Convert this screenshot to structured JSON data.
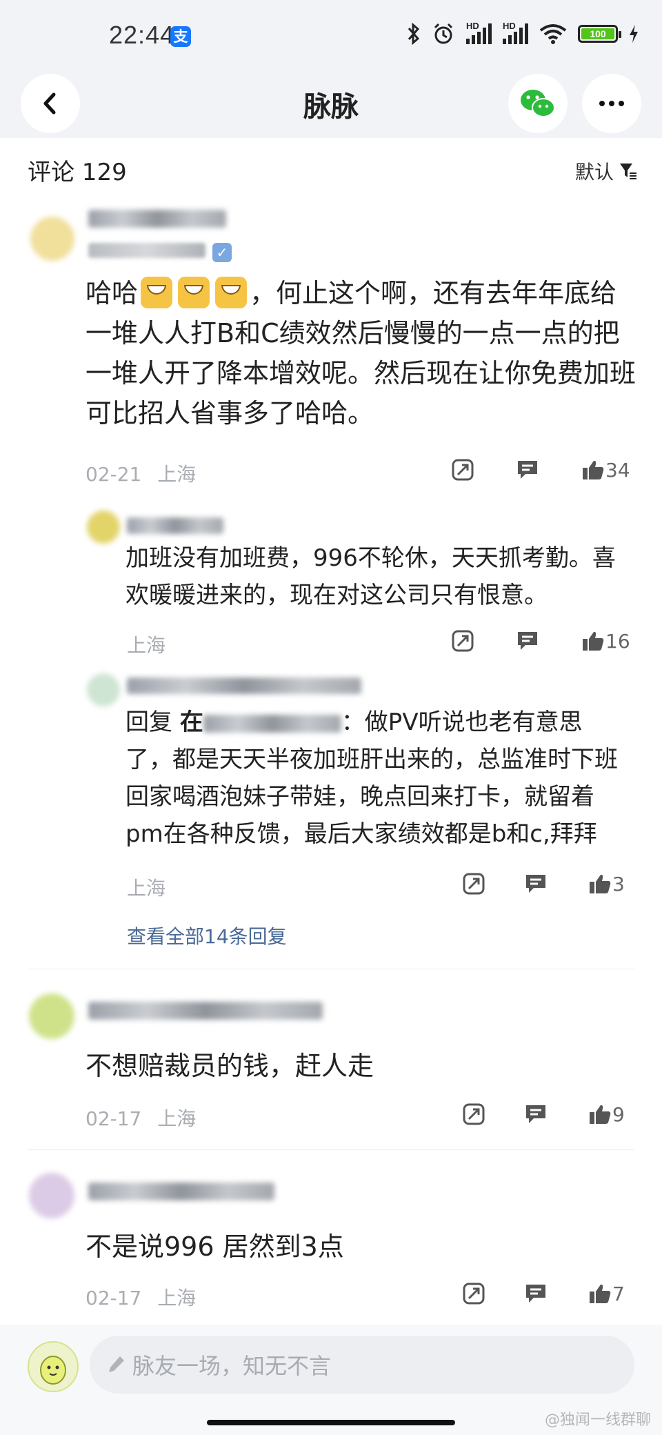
{
  "status_bar": {
    "time": "22:44",
    "alipay_badge": "支",
    "signal_badge_1": "HD",
    "signal_badge_2": "HD",
    "battery": "100"
  },
  "nav": {
    "title": "脉脉"
  },
  "comments_header": {
    "label": "评论 129",
    "sort_label": "默认"
  },
  "comments": [
    {
      "text_parts": [
        "哈哈",
        "，何止这个啊，还有去年年底给一堆人人打B和C绩效然后慢慢的一点一点的把一堆人开了降本增效呢。然后现在让你免费加班可比招人省事多了哈哈。"
      ],
      "date": "02-21",
      "location": "上海",
      "likes": "34",
      "replies": [
        {
          "text": "加班没有加班费，996不轮休，天天抓考勤。喜欢暖暖进来的，现在对这公司只有恨意。",
          "location": "上海",
          "likes": "16"
        },
        {
          "reply_prefix": "回复",
          "reply_to": "在",
          "text": "：做PV听说也老有意思了，都是天天半夜加班肝出来的，总监准时下班回家喝酒泡妹子带娃，晚点回来打卡，就留着pm在各种反馈，最后大家绩效都是b和c,拜拜",
          "location": "上海",
          "likes": "3"
        }
      ],
      "view_all": "查看全部14条回复"
    },
    {
      "text": "不想赔裁员的钱，赶人走",
      "date": "02-17",
      "location": "上海",
      "likes": "9"
    },
    {
      "text": "不是说996 居然到3点",
      "date": "02-17",
      "location": "上海",
      "likes": "7"
    }
  ],
  "input": {
    "placeholder": "脉友一场，知无不言"
  },
  "watermark": "@独闻一线群聊"
}
